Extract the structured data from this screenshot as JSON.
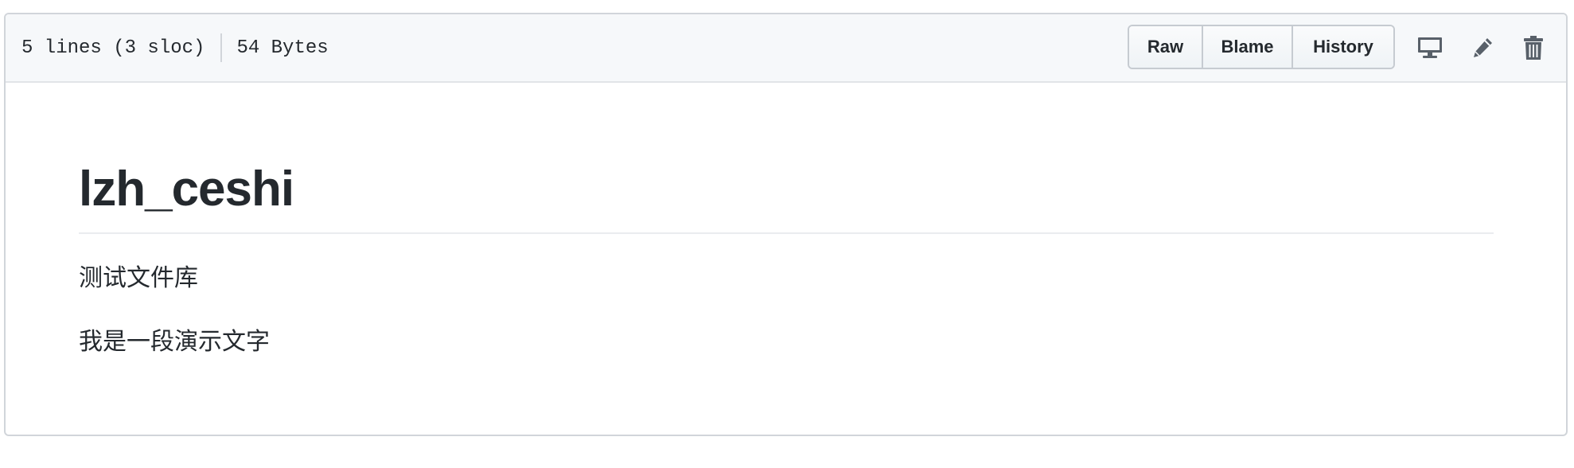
{
  "file_header": {
    "lines_info": "5 lines (3 sloc)",
    "size_info": "54 Bytes",
    "buttons": {
      "raw": "Raw",
      "blame": "Blame",
      "history": "History"
    },
    "icons": [
      "desktop-icon",
      "pencil-icon",
      "trash-icon"
    ]
  },
  "readme": {
    "title": "lzh_ceshi",
    "paragraphs": [
      "测试文件库",
      "我是一段演示文字"
    ]
  },
  "colors": {
    "header_bg": "#f6f8fa",
    "border": "#d1d5da",
    "text": "#24292e",
    "icon": "#586069"
  }
}
